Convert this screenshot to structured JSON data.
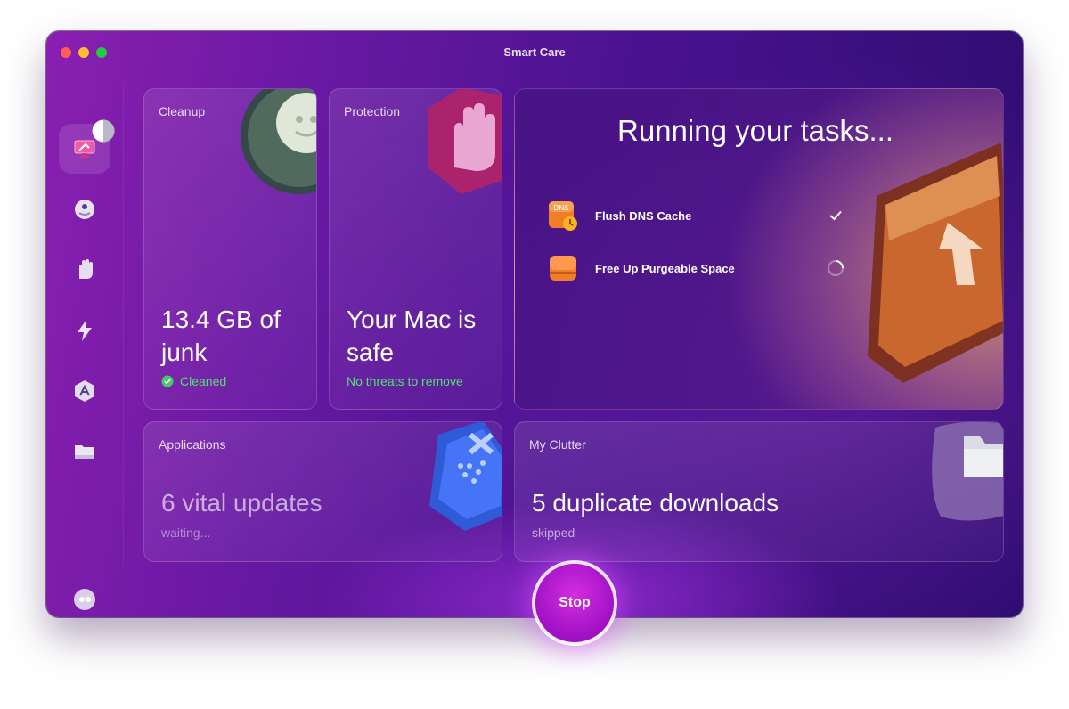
{
  "window": {
    "title": "Smart Care"
  },
  "sidebar": {
    "items": [
      {
        "icon": "smart-care-icon",
        "active": true
      },
      {
        "icon": "cleanup-icon"
      },
      {
        "icon": "protection-hand-icon"
      },
      {
        "icon": "speed-bolt-icon"
      },
      {
        "icon": "applications-icon"
      },
      {
        "icon": "files-folder-icon"
      }
    ],
    "assistant_icon": "assistant-icon"
  },
  "cards": {
    "cleanup": {
      "label": "Cleanup",
      "headline": "13.4 GB of junk",
      "status": "Cleaned"
    },
    "protection": {
      "label": "Protection",
      "headline": "Your Mac is safe",
      "status": "No threats to remove"
    },
    "applications": {
      "label": "Applications",
      "headline": "6 vital updates",
      "status": "waiting..."
    },
    "clutter": {
      "label": "My Clutter",
      "headline": "5 duplicate downloads",
      "status": "skipped"
    }
  },
  "tasks": {
    "title": "Running your tasks...",
    "items": [
      {
        "name": "Flush DNS Cache",
        "icon_text": "DNS",
        "state": "done"
      },
      {
        "name": "Free Up Purgeable Space",
        "state": "running"
      }
    ]
  },
  "stop_button": {
    "label": "Stop"
  },
  "colors": {
    "accent": "#a010c4",
    "success": "#52e06f"
  }
}
